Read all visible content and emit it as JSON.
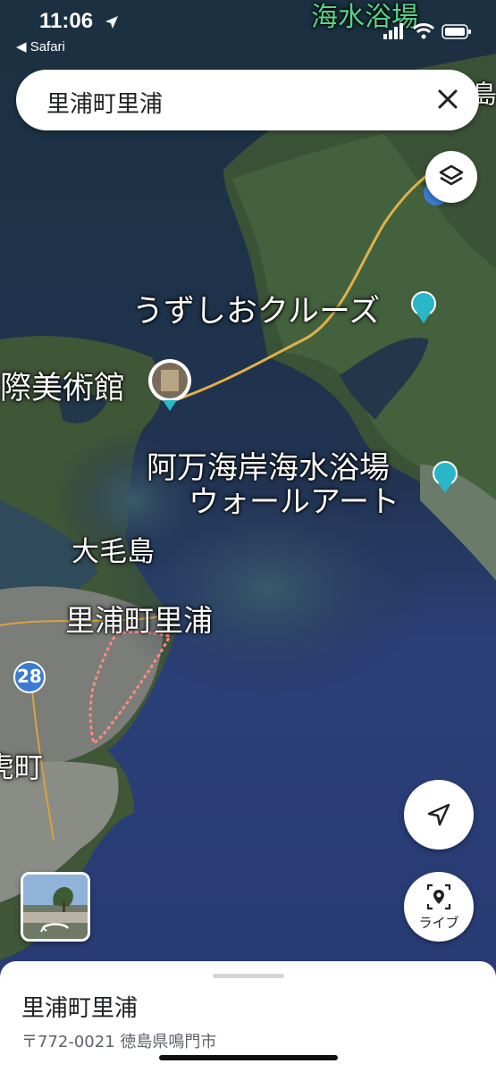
{
  "status": {
    "time": "11:06",
    "back_app": "Safari",
    "icons": [
      "location-arrow-icon",
      "signal-icon",
      "wifi-icon",
      "battery-icon"
    ]
  },
  "search": {
    "query": "里浦町里浦",
    "clear_icon": "close-icon"
  },
  "map_labels": {
    "top": "海水浴場",
    "top_right_fragment": "島",
    "cruise": "うずしおクルーズ",
    "museum": "際美術館",
    "beach_line1": "阿万海岸海水浴場",
    "beach_line2": "ウォールアート",
    "island": "大毛島",
    "place": "里浦町里浦",
    "route": "28",
    "left_fragment": "虎町"
  },
  "controls": {
    "layers_icon": "layers-icon",
    "locate_icon": "navigation-arrow-icon",
    "live_label": "ライブ",
    "live_icon": "live-view-icon"
  },
  "place": {
    "title": "里浦町里浦",
    "address": "〒772-0021 徳島県鳴門市"
  },
  "colors": {
    "sea_deep": "#26386e",
    "sea_dark": "#1d3345",
    "land": "#3f5a3a",
    "pin_teal": "#29b6c8",
    "route_badge": "#3b7bd1",
    "boundary": "#ff8a80"
  }
}
